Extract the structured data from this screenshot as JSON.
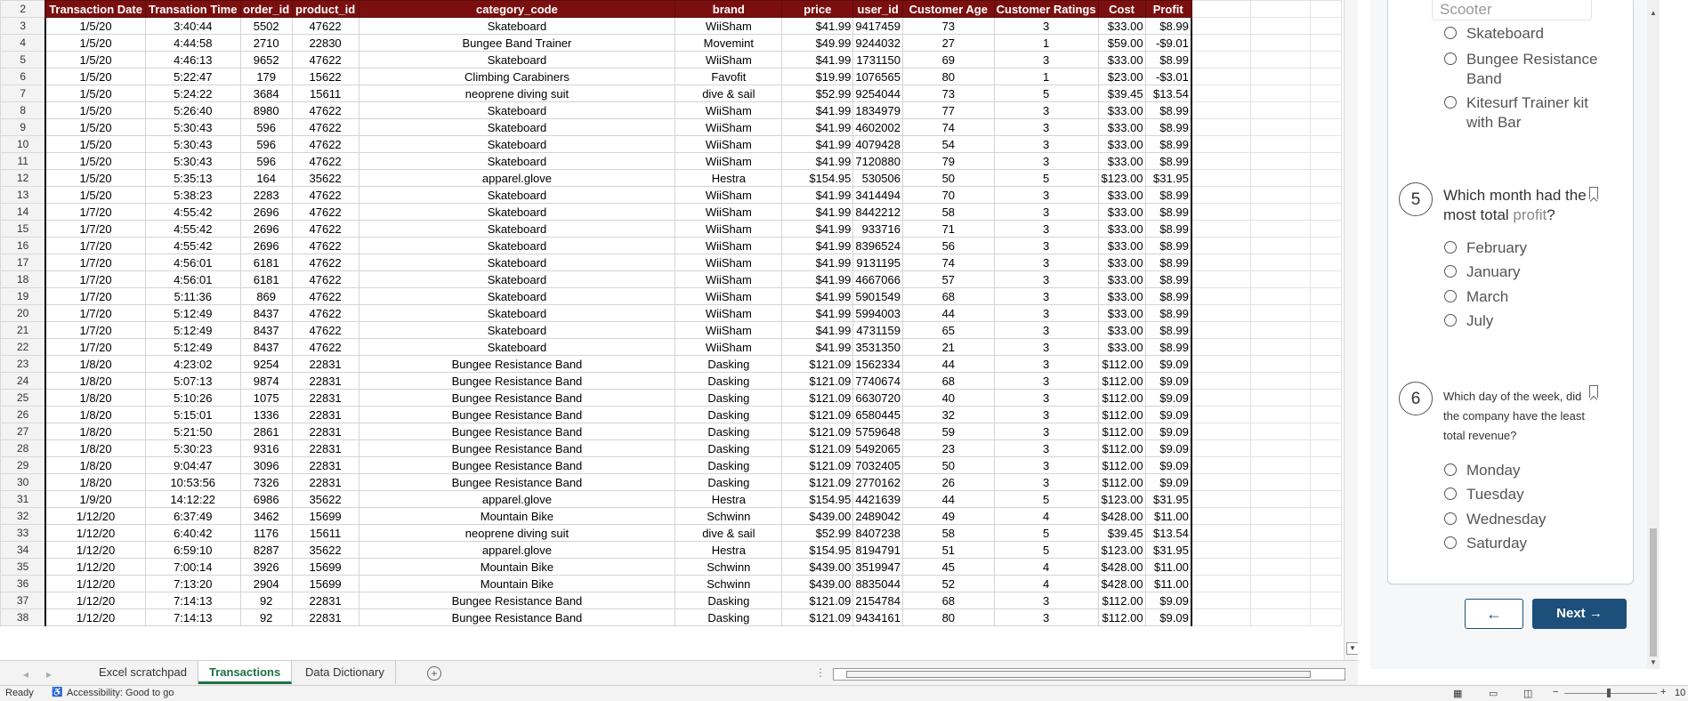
{
  "spreadsheet": {
    "headers": [
      "Transaction Date",
      "Transation Time",
      "order_id",
      "product_id",
      "category_code",
      "brand",
      "price",
      "user_id",
      "Customer Age",
      "Customer Ratings",
      "Cost",
      "Profit"
    ],
    "header_row_number": "2",
    "rows": [
      [
        "3",
        "1/5/20",
        "3:40:44",
        "5502",
        "47622",
        "Skateboard",
        "WiiSham",
        "$41.99",
        "9417459",
        "73",
        "3",
        "$33.00",
        "$8.99"
      ],
      [
        "4",
        "1/5/20",
        "4:44:58",
        "2710",
        "22830",
        "Bungee Band Trainer",
        "Movemint",
        "$49.99",
        "9244032",
        "27",
        "1",
        "$59.00",
        "-$9.01"
      ],
      [
        "5",
        "1/5/20",
        "4:46:13",
        "9652",
        "47622",
        "Skateboard",
        "WiiSham",
        "$41.99",
        "1731150",
        "69",
        "3",
        "$33.00",
        "$8.99"
      ],
      [
        "6",
        "1/5/20",
        "5:22:47",
        "179",
        "15622",
        "Climbing Carabiners",
        "Favofit",
        "$19.99",
        "1076565",
        "80",
        "1",
        "$23.00",
        "-$3.01"
      ],
      [
        "7",
        "1/5/20",
        "5:24:22",
        "3684",
        "15611",
        "neoprene diving suit",
        "dive & sail",
        "$52.99",
        "9254044",
        "73",
        "5",
        "$39.45",
        "$13.54"
      ],
      [
        "8",
        "1/5/20",
        "5:26:40",
        "8980",
        "47622",
        "Skateboard",
        "WiiSham",
        "$41.99",
        "1834979",
        "77",
        "3",
        "$33.00",
        "$8.99"
      ],
      [
        "9",
        "1/5/20",
        "5:30:43",
        "596",
        "47622",
        "Skateboard",
        "WiiSham",
        "$41.99",
        "4602002",
        "74",
        "3",
        "$33.00",
        "$8.99"
      ],
      [
        "10",
        "1/5/20",
        "5:30:43",
        "596",
        "47622",
        "Skateboard",
        "WiiSham",
        "$41.99",
        "4079428",
        "54",
        "3",
        "$33.00",
        "$8.99"
      ],
      [
        "11",
        "1/5/20",
        "5:30:43",
        "596",
        "47622",
        "Skateboard",
        "WiiSham",
        "$41.99",
        "7120880",
        "79",
        "3",
        "$33.00",
        "$8.99"
      ],
      [
        "12",
        "1/5/20",
        "5:35:13",
        "164",
        "35622",
        "apparel.glove",
        "Hestra",
        "$154.95",
        "530506",
        "50",
        "5",
        "$123.00",
        "$31.95"
      ],
      [
        "13",
        "1/5/20",
        "5:38:23",
        "2283",
        "47622",
        "Skateboard",
        "WiiSham",
        "$41.99",
        "3414494",
        "70",
        "3",
        "$33.00",
        "$8.99"
      ],
      [
        "14",
        "1/7/20",
        "4:55:42",
        "2696",
        "47622",
        "Skateboard",
        "WiiSham",
        "$41.99",
        "8442212",
        "58",
        "3",
        "$33.00",
        "$8.99"
      ],
      [
        "15",
        "1/7/20",
        "4:55:42",
        "2696",
        "47622",
        "Skateboard",
        "WiiSham",
        "$41.99",
        "933716",
        "71",
        "3",
        "$33.00",
        "$8.99"
      ],
      [
        "16",
        "1/7/20",
        "4:55:42",
        "2696",
        "47622",
        "Skateboard",
        "WiiSham",
        "$41.99",
        "8396524",
        "56",
        "3",
        "$33.00",
        "$8.99"
      ],
      [
        "17",
        "1/7/20",
        "4:56:01",
        "6181",
        "47622",
        "Skateboard",
        "WiiSham",
        "$41.99",
        "9131195",
        "74",
        "3",
        "$33.00",
        "$8.99"
      ],
      [
        "18",
        "1/7/20",
        "4:56:01",
        "6181",
        "47622",
        "Skateboard",
        "WiiSham",
        "$41.99",
        "4667066",
        "57",
        "3",
        "$33.00",
        "$8.99"
      ],
      [
        "19",
        "1/7/20",
        "5:11:36",
        "869",
        "47622",
        "Skateboard",
        "WiiSham",
        "$41.99",
        "5901549",
        "68",
        "3",
        "$33.00",
        "$8.99"
      ],
      [
        "20",
        "1/7/20",
        "5:12:49",
        "8437",
        "47622",
        "Skateboard",
        "WiiSham",
        "$41.99",
        "5994003",
        "44",
        "3",
        "$33.00",
        "$8.99"
      ],
      [
        "21",
        "1/7/20",
        "5:12:49",
        "8437",
        "47622",
        "Skateboard",
        "WiiSham",
        "$41.99",
        "4731159",
        "65",
        "3",
        "$33.00",
        "$8.99"
      ],
      [
        "22",
        "1/7/20",
        "5:12:49",
        "8437",
        "47622",
        "Skateboard",
        "WiiSham",
        "$41.99",
        "3531350",
        "21",
        "3",
        "$33.00",
        "$8.99"
      ],
      [
        "23",
        "1/8/20",
        "4:23:02",
        "9254",
        "22831",
        "Bungee Resistance Band",
        "Dasking",
        "$121.09",
        "1562334",
        "44",
        "3",
        "$112.00",
        "$9.09"
      ],
      [
        "24",
        "1/8/20",
        "5:07:13",
        "9874",
        "22831",
        "Bungee Resistance Band",
        "Dasking",
        "$121.09",
        "7740674",
        "68",
        "3",
        "$112.00",
        "$9.09"
      ],
      [
        "25",
        "1/8/20",
        "5:10:26",
        "1075",
        "22831",
        "Bungee Resistance Band",
        "Dasking",
        "$121.09",
        "6630720",
        "40",
        "3",
        "$112.00",
        "$9.09"
      ],
      [
        "26",
        "1/8/20",
        "5:15:01",
        "1336",
        "22831",
        "Bungee Resistance Band",
        "Dasking",
        "$121.09",
        "6580445",
        "32",
        "3",
        "$112.00",
        "$9.09"
      ],
      [
        "27",
        "1/8/20",
        "5:21:50",
        "2861",
        "22831",
        "Bungee Resistance Band",
        "Dasking",
        "$121.09",
        "5759648",
        "59",
        "3",
        "$112.00",
        "$9.09"
      ],
      [
        "28",
        "1/8/20",
        "5:30:23",
        "9316",
        "22831",
        "Bungee Resistance Band",
        "Dasking",
        "$121.09",
        "5492065",
        "23",
        "3",
        "$112.00",
        "$9.09"
      ],
      [
        "29",
        "1/8/20",
        "9:04:47",
        "3096",
        "22831",
        "Bungee Resistance Band",
        "Dasking",
        "$121.09",
        "7032405",
        "50",
        "3",
        "$112.00",
        "$9.09"
      ],
      [
        "30",
        "1/8/20",
        "10:53:56",
        "7326",
        "22831",
        "Bungee Resistance Band",
        "Dasking",
        "$121.09",
        "2770162",
        "26",
        "3",
        "$112.00",
        "$9.09"
      ],
      [
        "31",
        "1/9/20",
        "14:12:22",
        "6986",
        "35622",
        "apparel.glove",
        "Hestra",
        "$154.95",
        "4421639",
        "44",
        "5",
        "$123.00",
        "$31.95"
      ],
      [
        "32",
        "1/12/20",
        "6:37:49",
        "3462",
        "15699",
        "Mountain Bike",
        "Schwinn",
        "$439.00",
        "2489042",
        "49",
        "4",
        "$428.00",
        "$11.00"
      ],
      [
        "33",
        "1/12/20",
        "6:40:42",
        "1176",
        "15611",
        "neoprene diving suit",
        "dive & sail",
        "$52.99",
        "8407238",
        "58",
        "5",
        "$39.45",
        "$13.54"
      ],
      [
        "34",
        "1/12/20",
        "6:59:10",
        "8287",
        "35622",
        "apparel.glove",
        "Hestra",
        "$154.95",
        "8194791",
        "51",
        "5",
        "$123.00",
        "$31.95"
      ],
      [
        "35",
        "1/12/20",
        "7:00:14",
        "3926",
        "15699",
        "Mountain Bike",
        "Schwinn",
        "$439.00",
        "3519947",
        "45",
        "4",
        "$428.00",
        "$11.00"
      ],
      [
        "36",
        "1/12/20",
        "7:13:20",
        "2904",
        "15699",
        "Mountain Bike",
        "Schwinn",
        "$439.00",
        "8835044",
        "52",
        "4",
        "$428.00",
        "$11.00"
      ],
      [
        "37",
        "1/12/20",
        "7:14:13",
        "92",
        "22831",
        "Bungee Resistance Band",
        "Dasking",
        "$121.09",
        "2154784",
        "68",
        "3",
        "$112.00",
        "$9.09"
      ],
      [
        "38",
        "1/12/20",
        "7:14:13",
        "92",
        "22831",
        "Bungee Resistance Band",
        "Dasking",
        "$121.09",
        "9434161",
        "80",
        "3",
        "$112.00",
        "$9.09"
      ]
    ]
  },
  "sheet_tabs": [
    "Excel scratchpad",
    "Transactions",
    "Data Dictionary"
  ],
  "active_tab": "Transactions",
  "status": {
    "ready": "Ready",
    "accessibility": "Accessibility: Good to go",
    "zoom": "10"
  },
  "quiz": {
    "partial_prev_option": "Scooter",
    "prev_options": [
      "Skateboard",
      "Bungee Resistance Band",
      "Kitesurf Trainer kit with Bar"
    ],
    "q5": {
      "number": "5",
      "text_before": "Which month had the most total ",
      "text_keyword": "profit",
      "text_after": "?",
      "options": [
        "February",
        "January",
        "March",
        "July"
      ]
    },
    "q6": {
      "number": "6",
      "text": "Which day of the week, did the company have the least total revenue?",
      "options": [
        "Monday",
        "Tuesday",
        "Wednesday",
        "Saturday"
      ]
    },
    "back_arrow": "←",
    "next_label": "Next",
    "next_arrow": "→"
  },
  "colors": {
    "header_bg": "#7b0f0f",
    "active_tab": "#1e7145",
    "primary_button": "#1c4f7a",
    "keyword": "#888888"
  }
}
